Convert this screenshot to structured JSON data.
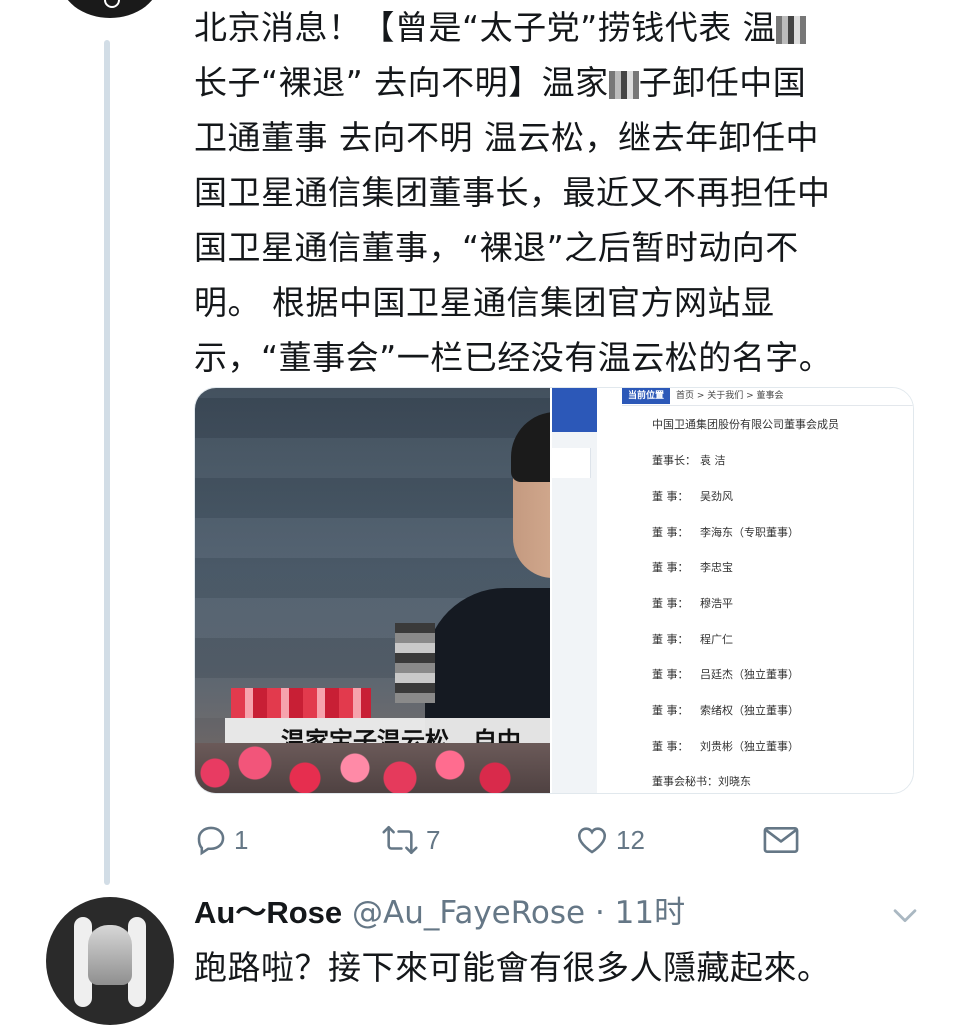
{
  "tweet": {
    "text_lines": [
      "北京消息！【曾是“太子党”捞钱代表 温",
      "长子“裸退” 去向不明】温家",
      "子卸任中国",
      "卫通董事 去向不明 温云松，继去年卸任中",
      "国卫星通信集团董事长，最近又不再担任中",
      "国卫星通信董事，“裸退”之后暂时动向不",
      "明。 根据中国卫星通信集团官方网站显",
      "示，“董事会”一栏已经没有温云松的名字。"
    ],
    "media": {
      "photo_caption": "温家宝子温云松，自中",
      "webpage": {
        "breadcrumb_label": "当前位置",
        "breadcrumb_path": "首页 > 关于我们 > 董事会",
        "company_title": "中国卫通集团股份有限公司董事会成员",
        "members": [
          {
            "role": "董事长：",
            "name": "袁  洁"
          },
          {
            "role": "董  事：",
            "name": "吴劲风"
          },
          {
            "role": "董  事：",
            "name": "李海东（专职董事）"
          },
          {
            "role": "董  事：",
            "name": "李忠宝"
          },
          {
            "role": "董  事：",
            "name": "穆浩平"
          },
          {
            "role": "董  事：",
            "name": "程广仁"
          },
          {
            "role": "董  事：",
            "name": "吕廷杰（独立董事）"
          },
          {
            "role": "董  事：",
            "name": "索绪权（独立董事）"
          },
          {
            "role": "董  事：",
            "name": "刘贵彬（独立董事）"
          }
        ],
        "secretary": "董事会秘书：刘晓东"
      }
    },
    "actions": {
      "reply_count": "1",
      "retweet_count": "7",
      "like_count": "12"
    }
  },
  "reply": {
    "display_name": "Au～Rose",
    "handle": "@Au_FayeRose",
    "separator": "·",
    "time": "11时",
    "text": "跑路啦？接下來可能會有很多人隱藏起來。"
  },
  "colors": {
    "text": "#14171a",
    "secondary": "#657786",
    "thread_line": "#d2dde6",
    "site_blue": "#2c58b8"
  },
  "icons": [
    "reply-icon",
    "retweet-icon",
    "like-icon",
    "dm-icon",
    "chevron-down-icon"
  ]
}
